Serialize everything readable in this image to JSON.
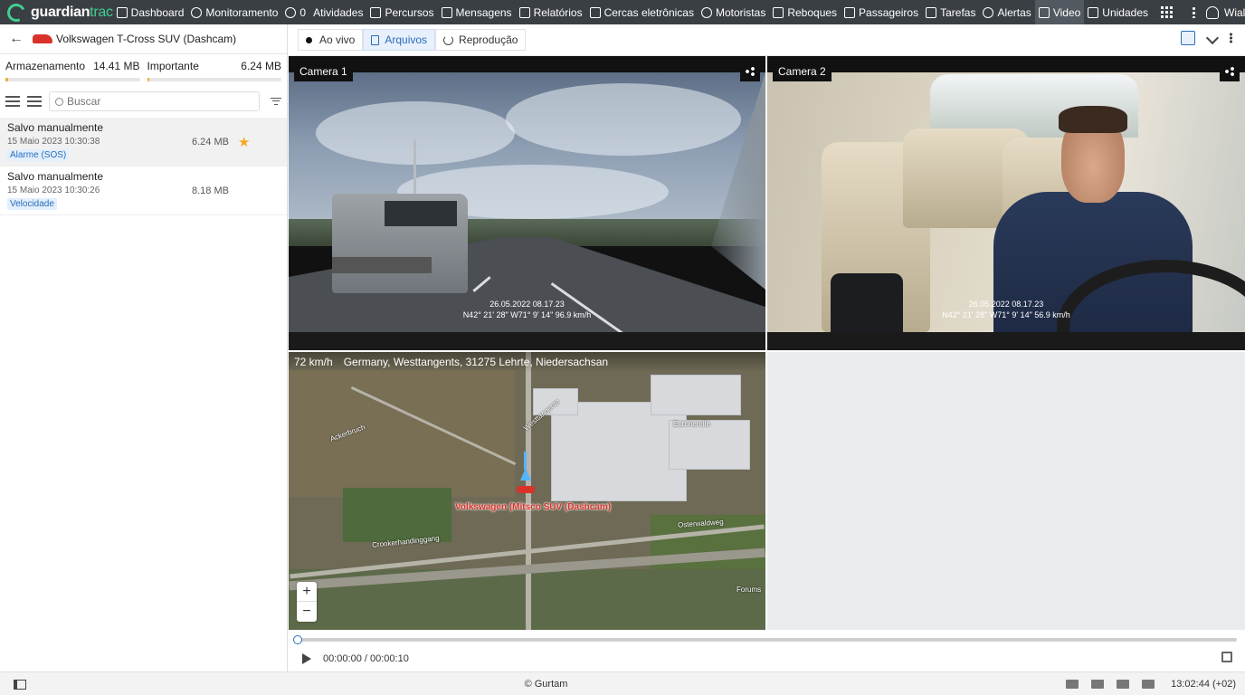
{
  "brand": {
    "part1": "guardian",
    "part2": "trac"
  },
  "nav": {
    "items": [
      {
        "label": "Dashboard",
        "icon": "bar-chart-icon"
      },
      {
        "label": "Monitoramento",
        "icon": "globe-icon"
      },
      {
        "label": "0",
        "icon": "check-circle-icon"
      },
      {
        "label": "Atividades",
        "icon": ""
      },
      {
        "label": "Percursos",
        "icon": "flag-icon"
      },
      {
        "label": "Mensagens",
        "icon": "message-icon"
      },
      {
        "label": "Relatórios",
        "icon": "report-icon"
      },
      {
        "label": "Cercas eletrônicas",
        "icon": "geofence-icon"
      },
      {
        "label": "Motoristas",
        "icon": "steering-wheel-icon"
      },
      {
        "label": "Reboques",
        "icon": "trailer-icon"
      },
      {
        "label": "Passageiros",
        "icon": "passenger-icon"
      },
      {
        "label": "Tarefas",
        "icon": "task-icon"
      },
      {
        "label": "Alertas",
        "icon": "alarm-icon"
      },
      {
        "label": "Video",
        "icon": "video-icon",
        "active": true
      },
      {
        "label": "Unidades",
        "icon": "unit-icon"
      }
    ],
    "user": "Wialon"
  },
  "unit": {
    "name": "Volkswagen T-Cross SUV (Dashcam)",
    "color": "#d9322b"
  },
  "storage": {
    "label": "Armazenamento",
    "value": "14.41 MB",
    "fill_fraction": 0.02,
    "important_label": "Importante",
    "important_value": "6.24 MB",
    "important_fill_fraction": 0.01
  },
  "search": {
    "placeholder": "Buscar"
  },
  "files": [
    {
      "title": "Salvo manualmente",
      "date": "15 Maio 2023 10:30:38",
      "size": "6.24 MB",
      "tag": "Alarme (SOS)",
      "starred": true,
      "selected": true
    },
    {
      "title": "Salvo manualmente",
      "date": "15 Maio 2023 10:30:26",
      "size": "8.18 MB",
      "tag": "Velocidade",
      "starred": false,
      "selected": false
    }
  ],
  "tabs": [
    {
      "label": "Ao vivo",
      "active": false
    },
    {
      "label": "Arquivos",
      "active": true
    },
    {
      "label": "Reprodução",
      "active": false
    }
  ],
  "cameras": [
    {
      "label": "Camera 1",
      "overlay_line1": "26.05.2022 08.17.23",
      "overlay_line2": "N42° 21' 28\" W71° 9' 14\" 96.9 km/h"
    },
    {
      "label": "Camera 2",
      "overlay_line1": "26.05.2022 08.17.23",
      "overlay_line2": "N42° 21' 28\" W71° 9' 14\" 56.9 km/h"
    }
  ],
  "map": {
    "speed": "72 km/h",
    "address": "Germany, Westtangents, 31275 Lehrte, Niedersachsan",
    "unit_label": "Volkswagen (Mitsco SUV (Dashcam)",
    "streets": [
      "Westtangente",
      "Euronerelle",
      "Ackerbruch",
      "Crookerhandinggang",
      "Osterwaldweg",
      "Forums"
    ],
    "zoom_in": "+",
    "zoom_out": "−"
  },
  "player": {
    "time": "00:00:00 / 00:00:10",
    "progress_fraction": 0.0
  },
  "footer": {
    "copyright": "© Gurtam",
    "time": "13:02:44 (+02)"
  },
  "colors": {
    "accent": "#2a6ebb",
    "brand_green": "#3fd08f",
    "star": "#f5a623",
    "topbar": "#3a3f44"
  }
}
